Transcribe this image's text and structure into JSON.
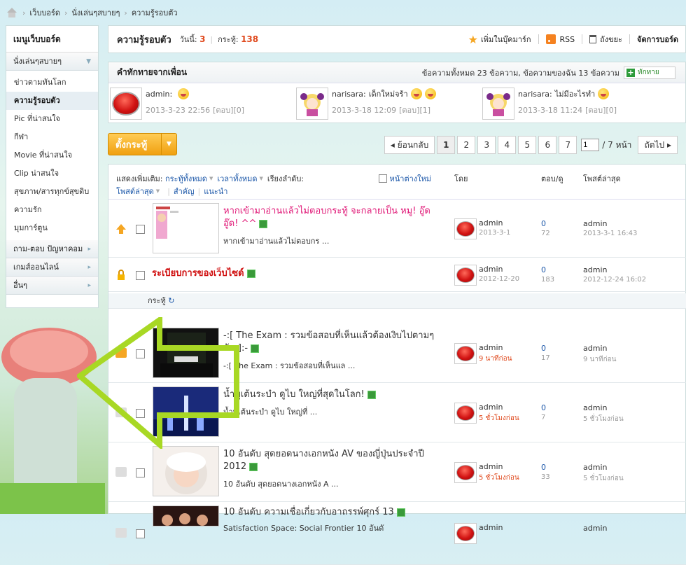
{
  "breadcrumb": {
    "home_icon": "home-icon",
    "items": [
      "เว็บบอร์ด",
      "นั่งเล่นๆสบายๆ",
      "ความรู้รอบตัว"
    ]
  },
  "sidebar": {
    "title": "เมนูเว็บบอร์ด",
    "group": "นั่งเล่นๆสบายๆ",
    "items": [
      "ข่าวตามทันโลก",
      "ความรู้รอบตัว",
      "Pic ที่น่าสนใจ",
      "กีฬา",
      "Movie ที่น่าสนใจ",
      "Clip น่าสนใจ",
      "สุขภาพ/สารทุกข์สุขดิบ",
      "ความรัก",
      "มุมการ์ตูน"
    ],
    "active_index": 1,
    "more_groups": [
      "ถาม-ตอบ ปัญหาคอม",
      "เกมส์ออนไลน์",
      "อื่นๆ"
    ]
  },
  "forum_head": {
    "title": "ความรู้รอบตัว",
    "today_label": "วันนี้:",
    "today_value": "3",
    "threads_label": "กระทู้:",
    "threads_value": "138",
    "bookmark": "เพิ่มในบุ๊คมาร์ก",
    "rss": "RSS",
    "recycle": "ถังขยะ",
    "manage": "จัดการบอร์ด"
  },
  "shoutbox": {
    "title": "คำทักทายจากเพื่อน",
    "info": "ข้อความทั้งหมด 23 ข้อความ, ข้อความของฉัน 13 ข้อความ",
    "button": "ทักทาย",
    "items": [
      {
        "user": "admin:",
        "text": "",
        "time": "2013-3-23 22:56",
        "reply": "[ตอบ][0]"
      },
      {
        "user": "narisara:",
        "text": "เด็กใหม่จร้า",
        "time": "2013-3-18 12:09",
        "reply": "[ตอบ][1]"
      },
      {
        "user": "narisara:",
        "text": "ไม่มีอะไรทำ",
        "time": "2013-3-18 11:24",
        "reply": "[ตอบ][0]"
      }
    ]
  },
  "post_button": "ตั้งกระทู้",
  "pager": {
    "prev": "ย้อนกลับ",
    "pages": [
      "1",
      "2",
      "3",
      "4",
      "5",
      "6",
      "7"
    ],
    "current": "1",
    "input_value": "1",
    "total": "/ 7 หน้า",
    "next": "ถัดไป"
  },
  "table_head": {
    "show": "แสดงเพิ่มเติม:",
    "all_threads": "กระทู้ทั้งหมด",
    "all_time": "เวลาทั้งหมด",
    "order": "เรียงลำดับ:",
    "last_post": "โพสต์ล่าสุด",
    "important": "สำคัญ",
    "recommend": "แนะนำ",
    "new_window": "หน้าต่างใหม่",
    "by": "โดย",
    "replies": "ตอบ/ดู",
    "latest": "โพสต์ล่าสุด"
  },
  "section_label": "กระทู้",
  "threads": [
    {
      "title": "หากเข้ามาอ่านแล้วไม่ตอบกระทู้ จะกลายเป็น หมู! อู๊ด อู๊ด! ^^",
      "preview": "หากเข้ามาอ่านแล้วไม่ตอบกร ...",
      "author": "admin",
      "date": "2013-3-1",
      "replies": "0",
      "views": "72",
      "last_user": "admin",
      "last_time": "2013-3-1 16:43"
    },
    {
      "title": "ระเบียบการของเว็บไซด์",
      "preview": "",
      "author": "admin",
      "date": "2012-12-20",
      "replies": "0",
      "views": "183",
      "last_user": "admin",
      "last_time": "2012-12-24 16:02"
    },
    {
      "title": "-:[ The Exam : รวมข้อสอบที่เห็นแล้วต้องเงิบไปตามๆ กัน ]:-",
      "preview": "-:[ The Exam : รวมข้อสอบที่เห็นแล ...",
      "author": "admin",
      "date": "9 นาทีก่อน",
      "replies": "0",
      "views": "17",
      "last_user": "admin",
      "last_time": "9 นาทีก่อน"
    },
    {
      "title": "น้ำพุเต้นระบำ ดูไบ ใหญ่ที่สุดในโลก!",
      "preview": "น้ำพุเต้นระบำ ดูไบ ใหญ่ที่ ...",
      "author": "admin",
      "date": "5 ชั่วโมงก่อน",
      "replies": "0",
      "views": "7",
      "last_user": "admin",
      "last_time": "5 ชั่วโมงก่อน"
    },
    {
      "title": "10 อันดับ สุดยอดนางเอกหนัง AV ของญี่ปุ่นประจำปี 2012",
      "preview": "10 อันดับ สุดยอดนางเอกหนัง A ...",
      "author": "admin",
      "date": "5 ชั่วโมงก่อน",
      "replies": "0",
      "views": "33",
      "last_user": "admin",
      "last_time": "5 ชั่วโมงก่อน"
    },
    {
      "title": "10 อันดับ ความเชื่อเกี่ยวกับอาถรรพ์ศุกร์ 13",
      "preview": "Satisfaction Space: Social Frontier 10 อันดั",
      "author": "admin",
      "date": "",
      "replies": "",
      "views": "",
      "last_user": "admin",
      "last_time": ""
    }
  ],
  "colors": {
    "accent": "#e04a1e",
    "link": "#1a56a8",
    "post_button": "#f0a010",
    "arrow": "#a8d824"
  }
}
